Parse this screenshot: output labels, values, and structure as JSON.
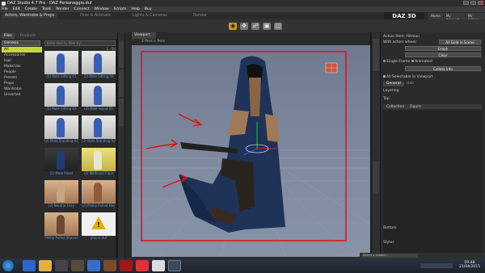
{
  "window": {
    "title": "DAZ Studio 4.7 Pro - DAZ Personaggio.duf"
  },
  "menu": [
    "File",
    "Edit",
    "Create",
    "Tools",
    "Render",
    "Connect",
    "Window",
    "Scripts",
    "Help",
    "Buy"
  ],
  "top_tabs": [
    "Actors, Wardrobe & Props",
    "Pose & Animate",
    "Lights & Cameras",
    "Render"
  ],
  "brand": "DAZ 3D",
  "top_links": [
    "Home",
    "My Account",
    "My Gallery"
  ],
  "left_panel": {
    "tabs": [
      "Files",
      "Products"
    ],
    "category_dropdown": "Genesis",
    "categories": [
      "All",
      "Accessories",
      "Hair",
      "Materials",
      "People",
      "Presets",
      "Props",
      "Wardrobe",
      "Unsorted"
    ],
    "search_placeholder": "Enter text to filter by...",
    "count": "1 - 54",
    "thumbnails": [
      {
        "label": "(2) Male Sitting 01",
        "style": "blue"
      },
      {
        "label": "(2) Male Sitting 02",
        "style": "blue"
      },
      {
        "label": "(2) Male Sitting 03",
        "style": "blue"
      },
      {
        "label": "(2) Male Squat 01",
        "style": "blue"
      },
      {
        "label": "(2) Male Standing 01",
        "style": "blue"
      },
      {
        "label": "(2) Male Standing 02",
        "style": "blue"
      },
      {
        "label": "(2) Male Priest",
        "style": "dark"
      },
      {
        "label": "(2) Medieval Cape",
        "style": "yellow"
      },
      {
        "label": "(2) Neutral Grey",
        "style": "skin"
      },
      {
        "label": "(2) Phillip Pulled Hair",
        "style": "skin"
      },
      {
        "label": "Phillip Pulled Shaved",
        "style": "skin"
      },
      {
        "label": "phone.duf",
        "style": "warn"
      }
    ]
  },
  "viewport": {
    "tab": "Viewport",
    "camera": "2 Pers e Pers"
  },
  "right_panel": {
    "active_item_label": "Active Item: Hitman",
    "with_actors": "With actors wheel:",
    "with_actors_value": "All Gold in Scene",
    "buttons": [
      "Graph",
      "Clear",
      "Collate Info"
    ],
    "single_frame": "Single Frame",
    "animated": "Animated",
    "all_selectable": "All Selectable In Viewport",
    "subtabs": [
      "General",
      "Hair"
    ],
    "layering": "Layering",
    "top": "Top",
    "columns": [
      "Collection",
      "Figure"
    ],
    "bottom": "Bottom",
    "styles": "Styles"
  },
  "statusbar": {
    "select_lesson": "Select a Lesson..."
  },
  "taskbar": {
    "time": "09:48",
    "date": "21/04/2015"
  }
}
